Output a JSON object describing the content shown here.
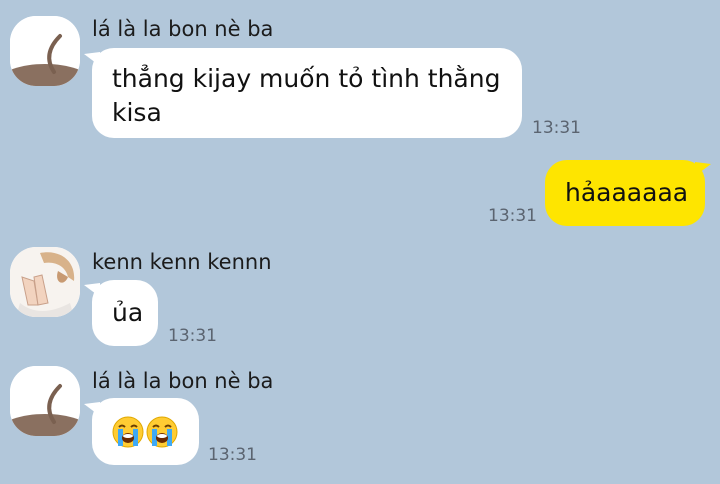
{
  "messages": [
    {
      "sender": "lá là la bon nè ba",
      "text": "thẳng kijay muốn tỏ tình thằng kisa",
      "time": "13:31",
      "outgoing": false
    },
    {
      "text": "hảaaaaaa",
      "time": "13:31",
      "outgoing": true
    },
    {
      "sender": "kenn kenn kennn",
      "text": "ủa",
      "time": "13:31",
      "outgoing": false
    },
    {
      "sender": "lá là la bon nè ba",
      "emojis": [
        "loudly-crying-face",
        "loudly-crying-face"
      ],
      "time": "13:31",
      "outgoing": false
    }
  ],
  "colors": {
    "background": "#b2c7da",
    "incoming_bubble": "#ffffff",
    "outgoing_bubble": "#fee500",
    "timestamp": "#5b6470"
  }
}
